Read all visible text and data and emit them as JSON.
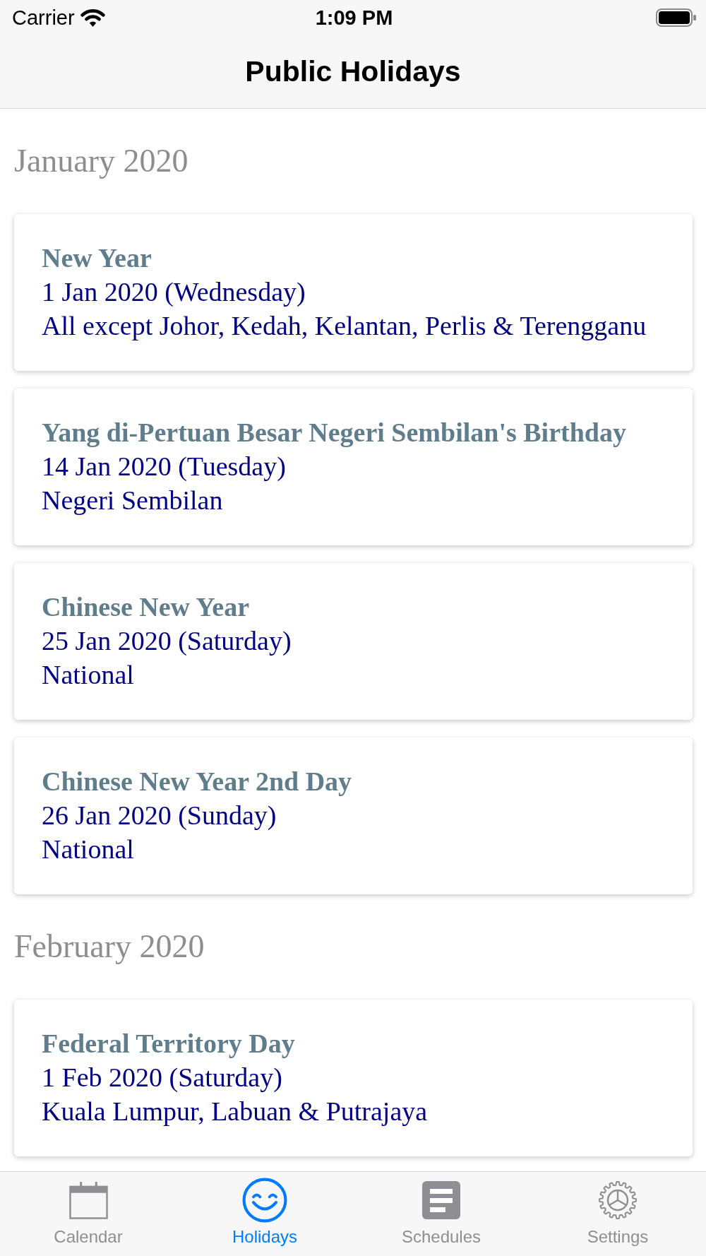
{
  "status_bar": {
    "carrier": "Carrier",
    "time": "1:09 PM"
  },
  "nav_bar": {
    "title": "Public Holidays"
  },
  "sections": [
    {
      "heading": "January 2020",
      "holidays": [
        {
          "name": "New Year",
          "date": "1 Jan 2020 (Wednesday)",
          "region": "All except Johor, Kedah, Kelantan, Perlis & Terengganu"
        },
        {
          "name": "Yang di-Pertuan Besar Negeri Sembilan's Birthday",
          "date": "14 Jan 2020 (Tuesday)",
          "region": "Negeri Sembilan"
        },
        {
          "name": "Chinese New Year",
          "date": "25 Jan 2020 (Saturday)",
          "region": "National"
        },
        {
          "name": "Chinese New Year 2nd Day",
          "date": "26 Jan 2020 (Sunday)",
          "region": "National"
        }
      ]
    },
    {
      "heading": "February 2020",
      "holidays": [
        {
          "name": "Federal Territory Day",
          "date": "1 Feb 2020 (Saturday)",
          "region": "Kuala Lumpur, Labuan & Putrajaya"
        }
      ]
    }
  ],
  "tab_bar": [
    {
      "label": "Calendar",
      "selected": false
    },
    {
      "label": "Holidays",
      "selected": true
    },
    {
      "label": "Schedules",
      "selected": false
    },
    {
      "label": "Settings",
      "selected": false
    }
  ]
}
